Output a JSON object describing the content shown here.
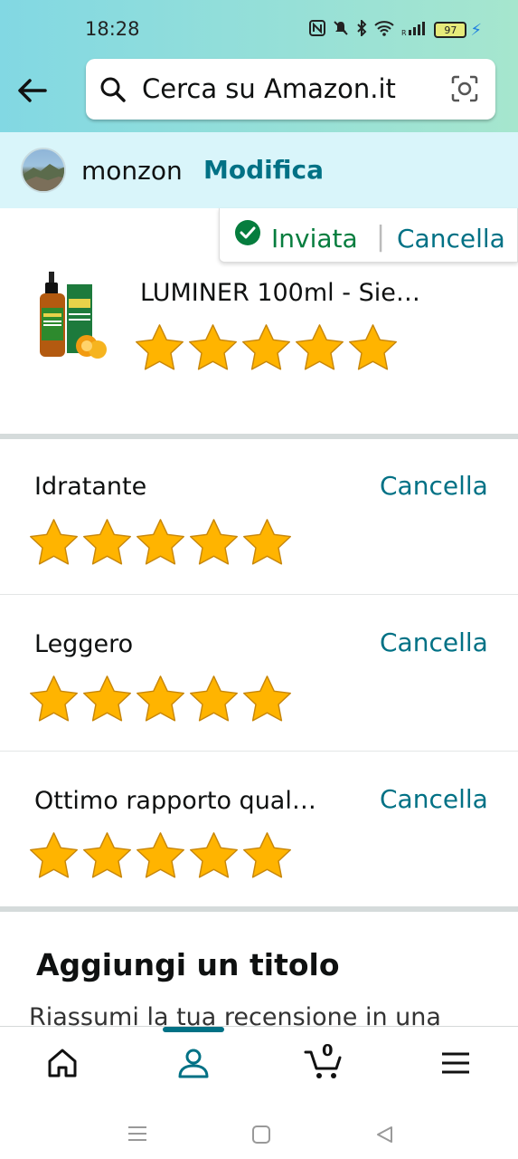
{
  "status": {
    "time": "18:28",
    "battery": "97"
  },
  "search": {
    "placeholder": "Cerca su Amazon.it"
  },
  "user": {
    "name": "monzon",
    "edit_label": "Modifica"
  },
  "review_status": {
    "sent_label": "Inviata",
    "cancel_label": "Cancella"
  },
  "product": {
    "title": "LUMINER 100ml - Sie…",
    "rating": 5
  },
  "attributes": [
    {
      "label": "Idratante",
      "cancel_label": "Cancella",
      "rating": 5
    },
    {
      "label": "Leggero",
      "cancel_label": "Cancella",
      "rating": 5
    },
    {
      "label": "Ottimo rapporto qual…",
      "cancel_label": "Cancella",
      "rating": 5
    }
  ],
  "title_section": {
    "heading": "Aggiungi un titolo",
    "description": "Riassumi la tua recensione in una"
  },
  "bottom_nav": {
    "cart_count": "0",
    "items": [
      "home-icon",
      "account-icon",
      "cart-icon",
      "menu-icon"
    ]
  },
  "colors": {
    "link": "#007185",
    "success": "#067d3e",
    "star": "#ffb400",
    "accent_bar": "#007185"
  }
}
